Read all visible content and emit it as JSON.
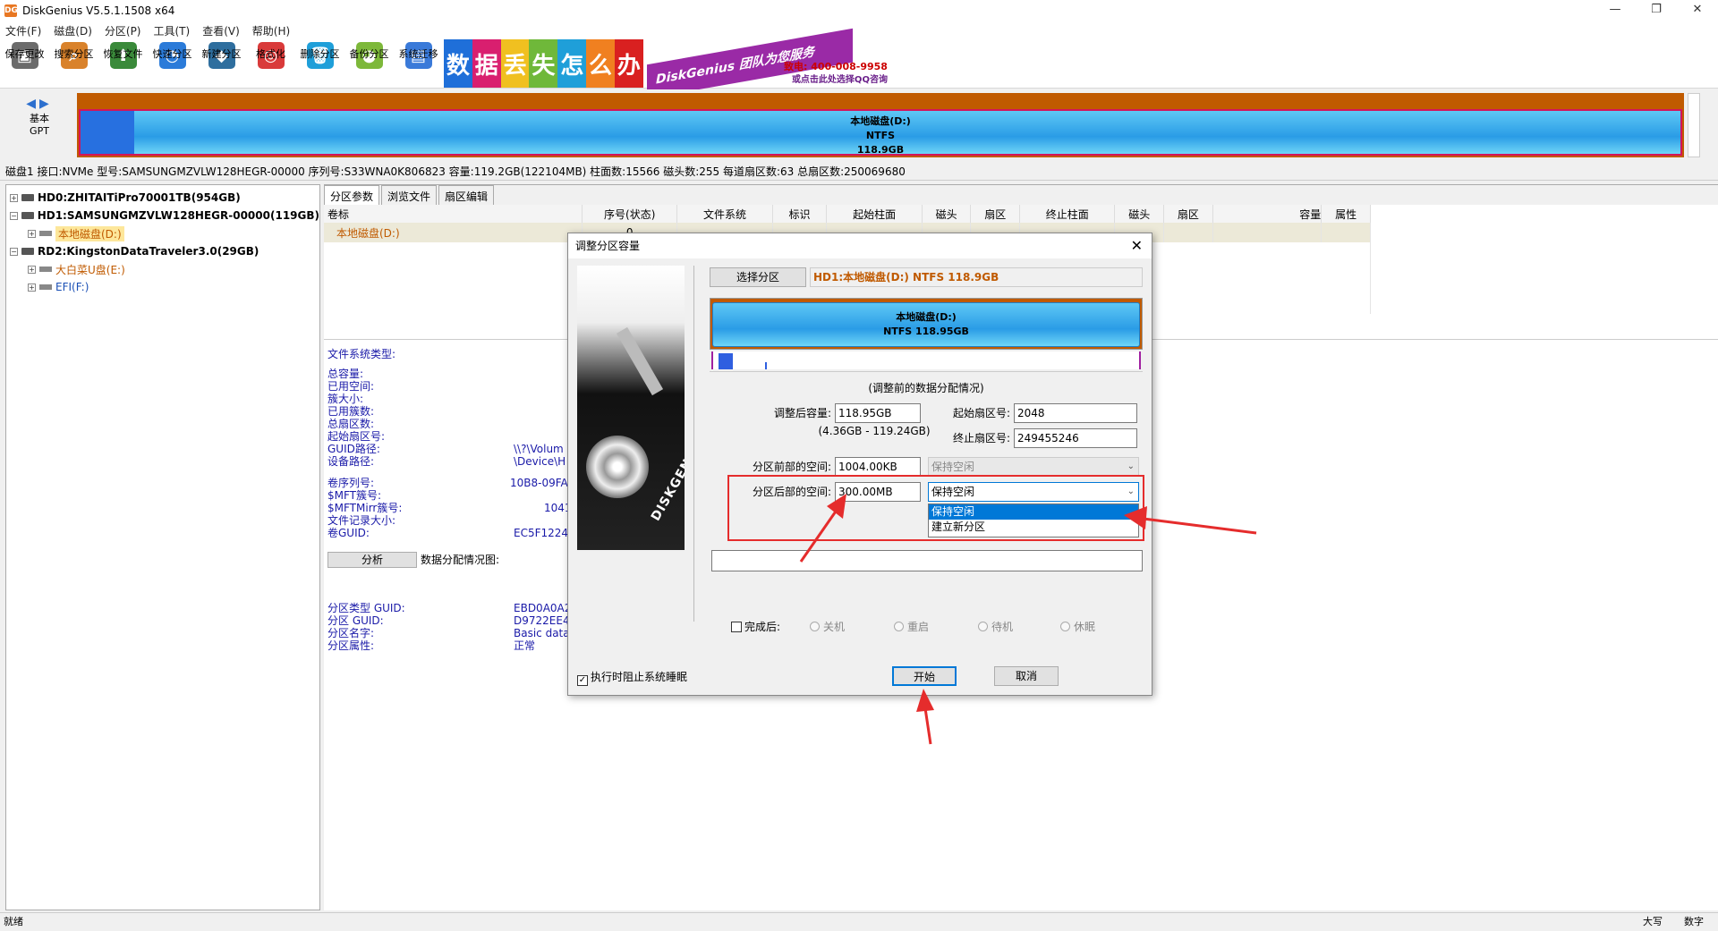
{
  "window": {
    "title": "DiskGenius V5.5.1.1508 x64",
    "app_icon": "DG",
    "controls": [
      "—",
      "❐",
      "✕"
    ]
  },
  "menu": [
    "文件(F)",
    "磁盘(D)",
    "分区(P)",
    "工具(T)",
    "查看(V)",
    "帮助(H)"
  ],
  "toolbar": [
    {
      "label": "保存更改",
      "icon": "save-icon",
      "color": "#6b6b6b"
    },
    {
      "label": "搜索分区",
      "icon": "search-icon",
      "color": "#d9822b"
    },
    {
      "label": "恢复文件",
      "icon": "recover-icon",
      "color": "#3a8a3a"
    },
    {
      "label": "快速分区",
      "icon": "quick-partition-icon",
      "color": "#2b7bd9"
    },
    {
      "label": "新建分区",
      "icon": "new-partition-icon",
      "color": "#2e6e9e"
    },
    {
      "label": "格式化",
      "icon": "format-icon",
      "color": "#d93a3a"
    },
    {
      "label": "删除分区",
      "icon": "delete-icon",
      "color": "#1f9fd9"
    },
    {
      "label": "备份分区",
      "icon": "backup-icon",
      "color": "#7db83a"
    },
    {
      "label": "系统迁移",
      "icon": "migrate-icon",
      "color": "#3a7ad9"
    }
  ],
  "banner": {
    "blocks": [
      {
        "char": "数",
        "color": "#1f6fd9"
      },
      {
        "char": "据",
        "color": "#d91f6f"
      },
      {
        "char": "丢",
        "color": "#f0c020"
      },
      {
        "char": "失",
        "color": "#6fb83a"
      },
      {
        "char": "怎",
        "color": "#1f9fd9"
      },
      {
        "char": "么",
        "color": "#f08020"
      },
      {
        "char": "办",
        "color": "#d92020"
      }
    ],
    "promo": "DiskGenius 团队为您服务",
    "tel": "致电: 400-008-9958",
    "qq": "或点击此处选择QQ咨询"
  },
  "disk_bar": {
    "nav_label_1": "基本",
    "nav_label_2": "GPT",
    "partition_name": "本地磁盘(D:)",
    "fs": "NTFS",
    "size": "118.9GB"
  },
  "disk_info": "磁盘1 接口:NVMe  型号:SAMSUNGMZVLW128HEGR-00000  序列号:S33WNA0K806823  容量:119.2GB(122104MB)  柱面数:15566  磁头数:255  每道扇区数:63  总扇区数:250069680",
  "tree": [
    {
      "label": "HD0:ZHITAITiPro70001TB(954GB)",
      "level": 0,
      "type": "disk",
      "style": "bold"
    },
    {
      "label": "HD1:SAMSUNGMZVLW128HEGR-00000(119GB)",
      "level": 0,
      "type": "disk",
      "style": "bold"
    },
    {
      "label": "本地磁盘(D:)",
      "level": 1,
      "type": "partition",
      "style": "selected"
    },
    {
      "label": "RD2:KingstonDataTraveler3.0(29GB)",
      "level": 0,
      "type": "disk",
      "style": "bold"
    },
    {
      "label": "大白菜U盘(E:)",
      "level": 1,
      "type": "partition",
      "style": "orange"
    },
    {
      "label": "EFI(F:)",
      "level": 1,
      "type": "partition",
      "style": "blue"
    }
  ],
  "tabs": [
    "分区参数",
    "浏览文件",
    "扇区编辑"
  ],
  "partition_table": {
    "headers": [
      "卷标",
      "序号(状态)",
      "文件系统",
      "标识",
      "起始柱面",
      "磁头",
      "扇区",
      "终止柱面",
      "磁头",
      "扇区",
      "容量",
      "属性"
    ],
    "row": [
      "本地磁盘(D:)",
      "0",
      "",
      "",
      "",
      "",
      "",
      "",
      "",
      "",
      "",
      ""
    ]
  },
  "fs_info": {
    "fs_type_label": "文件系统类型:",
    "labels_1": [
      "总容量:",
      "已用空间:",
      "簇大小:",
      "已用簇数:",
      "总扇区数:",
      "起始扇区号:",
      "GUID路径:",
      "设备路径:"
    ],
    "values_1": [
      "",
      "",
      "",
      "",
      "",
      "",
      "\\\\?\\Volum",
      "\\Device\\H"
    ],
    "labels_2": [
      "卷序列号:",
      "$MFT簇号:",
      "$MFTMirr簇号:",
      "文件记录大小:",
      "卷GUID:"
    ],
    "values_2": [
      "10B8-09FA",
      "1041",
      "",
      "",
      "EC5F1224-"
    ],
    "analyze_button": "分析",
    "analyze_label": "数据分配情况图:",
    "labels_3": [
      "分区类型 GUID:",
      "分区 GUID:",
      "分区名字:",
      "分区属性:"
    ],
    "values_3": [
      "EBD0A0A2",
      "D9722EE4",
      "Basic data",
      "正常"
    ]
  },
  "status": {
    "ready": "就绪",
    "caps": "大写",
    "num": "数字"
  },
  "dialog": {
    "title": "调整分区容量",
    "close": "✕",
    "image_brand": "DISKGENIUS",
    "select_button": "选择分区",
    "partition_label": "HD1:本地磁盘(D:) NTFS 118.9GB",
    "bar_line1": "本地磁盘(D:)",
    "bar_line2": "NTFS 118.95GB",
    "usage_caption": "(调整前的数据分配情况)",
    "size_label": "调整后容量:",
    "size_value": "118.95GB",
    "size_range": "(4.36GB - 119.24GB)",
    "start_sector_label": "起始扇区号:",
    "start_sector_value": "2048",
    "end_sector_label": "终止扇区号:",
    "end_sector_value": "249455246",
    "before_label": "分区前部的空间:",
    "before_value": "1004.00KB",
    "before_option": "保持空闲",
    "after_label": "分区后部的空间:",
    "after_value": "300.00MB",
    "after_option": "保持空闲",
    "after_options": [
      "保持空闲",
      "建立新分区"
    ],
    "done_label": "完成后:",
    "done_options": [
      "关机",
      "重启",
      "待机",
      "休眠"
    ],
    "prevent_sleep": "执行时阻止系统睡眠",
    "start_button": "开始",
    "cancel_button": "取消"
  },
  "annotation_color": "#e52c2c"
}
